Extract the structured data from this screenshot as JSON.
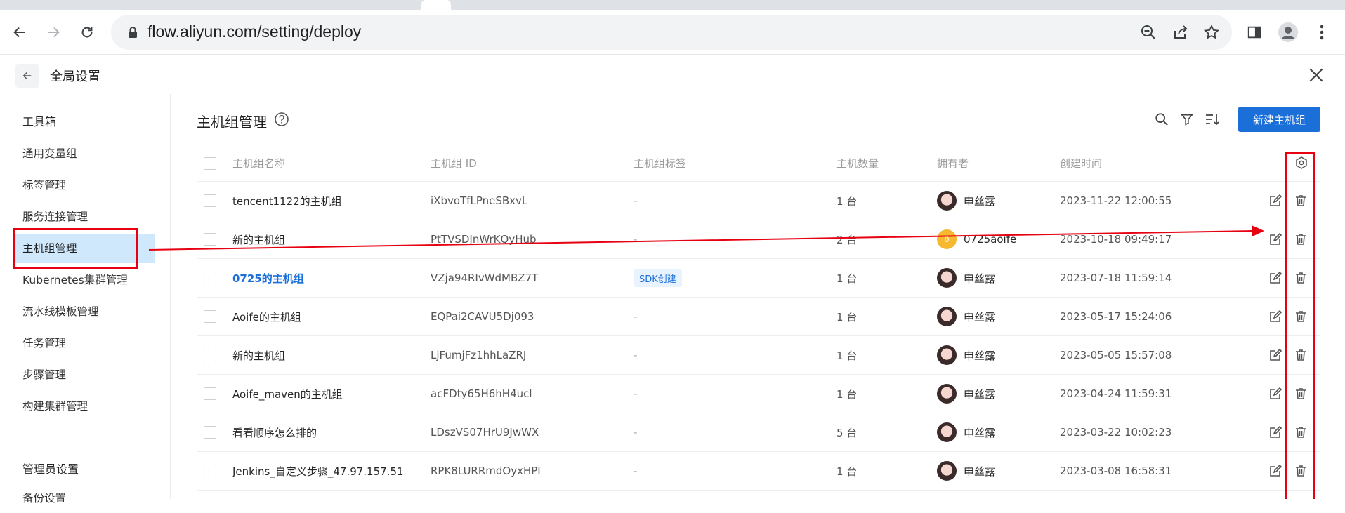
{
  "browser": {
    "url": "flow.aliyun.com/setting/deploy"
  },
  "app": {
    "title": "全局设置"
  },
  "sidebar": {
    "group1": "工具箱",
    "items": [
      {
        "label": "通用变量组"
      },
      {
        "label": "标签管理"
      },
      {
        "label": "服务连接管理"
      },
      {
        "label": "主机组管理"
      },
      {
        "label": "Kubernetes集群管理"
      },
      {
        "label": "流水线模板管理"
      },
      {
        "label": "任务管理"
      },
      {
        "label": "步骤管理"
      },
      {
        "label": "构建集群管理"
      }
    ],
    "group2": "管理员设置",
    "group2_item": "备份设置"
  },
  "page": {
    "title": "主机组管理",
    "new_button": "新建主机组"
  },
  "table": {
    "columns": {
      "name": "主机组名称",
      "id": "主机组 ID",
      "tags": "主机组标签",
      "count": "主机数量",
      "owner": "拥有者",
      "created": "创建时间"
    },
    "rows": [
      {
        "name": "tencent1122的主机组",
        "id": "iXbvoTfLPneSBxvL",
        "tag": "-",
        "count": "1 台",
        "owner": "申丝露",
        "created": "2023-11-22 12:00:55"
      },
      {
        "name": "新的主机组",
        "id": "PtTVSDJnWrKQyHub",
        "tag": "-",
        "count": "2 台",
        "owner": "0725aoife",
        "avatar_text": "0",
        "created": "2023-10-18 09:49:17"
      },
      {
        "name": "0725的主机组",
        "id": "VZja94RIvWdMBZ7T",
        "tag": "SDK创建",
        "count": "1 台",
        "owner": "申丝露",
        "created": "2023-07-18 11:59:14"
      },
      {
        "name": "Aoife的主机组",
        "id": "EQPai2CAVU5Dj093",
        "tag": "-",
        "count": "1 台",
        "owner": "申丝露",
        "created": "2023-05-17 15:24:06"
      },
      {
        "name": "新的主机组",
        "id": "LjFumjFz1hhLaZRJ",
        "tag": "-",
        "count": "1 台",
        "owner": "申丝露",
        "created": "2023-05-05 15:57:08"
      },
      {
        "name": "Aoife_maven的主机组",
        "id": "acFDty65H6hH4ucl",
        "tag": "-",
        "count": "1 台",
        "owner": "申丝露",
        "created": "2023-04-24 11:59:31"
      },
      {
        "name": "看看顺序怎么排的",
        "id": "LDszVS07HrU9JwWX",
        "tag": "-",
        "count": "5 台",
        "owner": "申丝露",
        "created": "2023-03-22 10:02:23"
      },
      {
        "name": "Jenkins_自定义步骤_47.97.157.51",
        "id": "RPK8LURRmdOyxHPI",
        "tag": "-",
        "count": "1 台",
        "owner": "申丝露",
        "created": "2023-03-08 16:58:31"
      }
    ]
  },
  "annotation_color": "#e60012",
  "accent_color": "#1b6fd9"
}
